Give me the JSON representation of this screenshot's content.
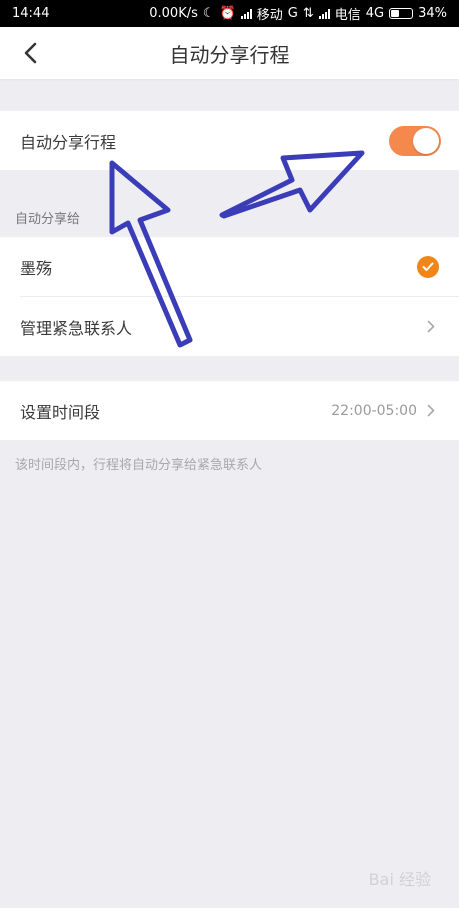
{
  "status_bar": {
    "time": "14:44",
    "net_speed": "0.00K/s",
    "carrier1": "移动",
    "net1": "G",
    "carrier2": "电信",
    "net2": "4G",
    "battery": "34%"
  },
  "header": {
    "title": "自动分享行程"
  },
  "auto_share": {
    "label": "自动分享行程",
    "enabled": true
  },
  "share_to": {
    "section_label": "自动分享给",
    "contact_name": "墨殇",
    "manage_label": "管理紧急联系人"
  },
  "time_period": {
    "label": "设置时间段",
    "value": "22:00-05:00",
    "hint": "该时间段内，行程将自动分享给紧急联系人"
  },
  "watermark": "Bai 经验",
  "colors": {
    "accent": "#f5884d",
    "check": "#f0861a",
    "arrow": "#3b3db8"
  }
}
